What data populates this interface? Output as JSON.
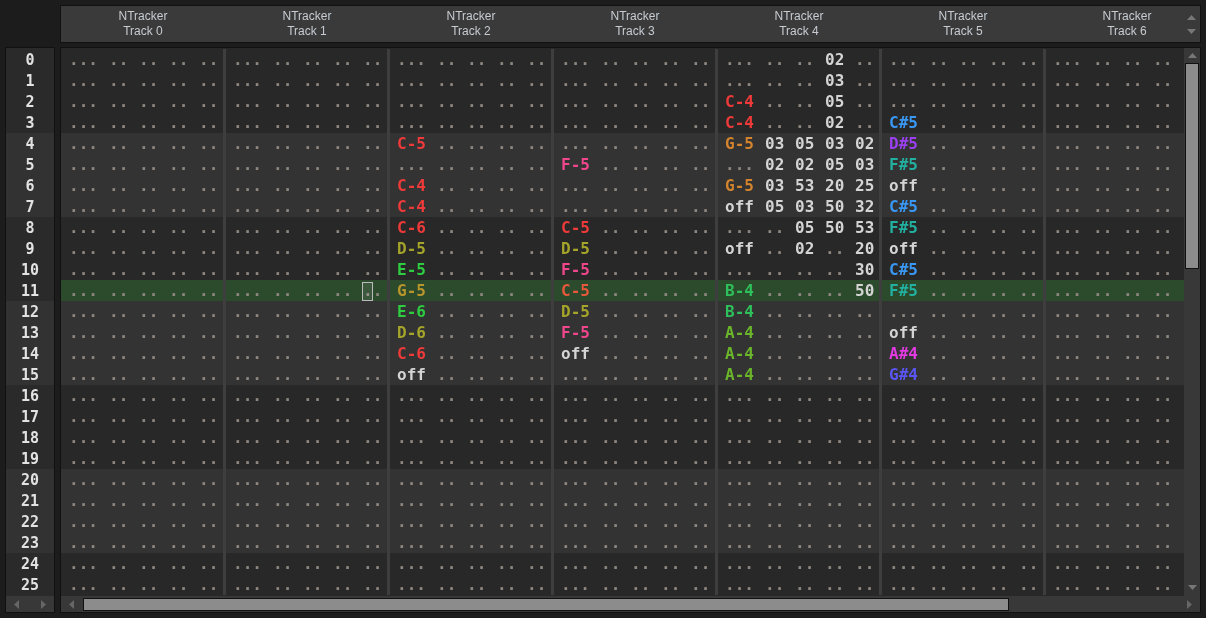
{
  "tracks": [
    {
      "plugin": "NTracker",
      "name": "Track 0",
      "rows": [
        {
          "note": "...",
          "fields": [
            "..",
            "..",
            "..",
            ".."
          ]
        },
        {
          "note": "...",
          "fields": [
            "..",
            "..",
            "..",
            ".."
          ]
        },
        {
          "note": "...",
          "fields": [
            "..",
            "..",
            "..",
            ".."
          ]
        },
        {
          "note": "...",
          "fields": [
            "..",
            "..",
            "..",
            ".."
          ]
        },
        {
          "note": "...",
          "fields": [
            "..",
            "..",
            "..",
            ".."
          ]
        },
        {
          "note": "...",
          "fields": [
            "..",
            "..",
            "..",
            ".."
          ]
        },
        {
          "note": "...",
          "fields": [
            "..",
            "..",
            "..",
            ".."
          ]
        },
        {
          "note": "...",
          "fields": [
            "..",
            "..",
            "..",
            ".."
          ]
        },
        {
          "note": "...",
          "fields": [
            "..",
            "..",
            "..",
            ".."
          ]
        },
        {
          "note": "...",
          "fields": [
            "..",
            "..",
            "..",
            ".."
          ]
        },
        {
          "note": "...",
          "fields": [
            "..",
            "..",
            "..",
            ".."
          ]
        },
        {
          "note": "...",
          "fields": [
            "..",
            "..",
            "..",
            ".."
          ]
        },
        {
          "note": "...",
          "fields": [
            "..",
            "..",
            "..",
            ".."
          ]
        },
        {
          "note": "...",
          "fields": [
            "..",
            "..",
            "..",
            ".."
          ]
        },
        {
          "note": "...",
          "fields": [
            "..",
            "..",
            "..",
            ".."
          ]
        },
        {
          "note": "...",
          "fields": [
            "..",
            "..",
            "..",
            ".."
          ]
        },
        {
          "note": "...",
          "fields": [
            "..",
            "..",
            "..",
            ".."
          ]
        },
        {
          "note": "...",
          "fields": [
            "..",
            "..",
            "..",
            ".."
          ]
        },
        {
          "note": "...",
          "fields": [
            "..",
            "..",
            "..",
            ".."
          ]
        },
        {
          "note": "...",
          "fields": [
            "..",
            "..",
            "..",
            ".."
          ]
        },
        {
          "note": "...",
          "fields": [
            "..",
            "..",
            "..",
            ".."
          ]
        },
        {
          "note": "...",
          "fields": [
            "..",
            "..",
            "..",
            ".."
          ]
        },
        {
          "note": "...",
          "fields": [
            "..",
            "..",
            "..",
            ".."
          ]
        },
        {
          "note": "...",
          "fields": [
            "..",
            "..",
            "..",
            ".."
          ]
        },
        {
          "note": "...",
          "fields": [
            "..",
            "..",
            "..",
            ".."
          ]
        },
        {
          "note": "...",
          "fields": [
            "..",
            "..",
            "..",
            ".."
          ]
        }
      ]
    },
    {
      "plugin": "NTracker",
      "name": "Track 1",
      "rows": [
        {
          "note": "...",
          "fields": [
            "..",
            "..",
            "..",
            ".."
          ]
        },
        {
          "note": "...",
          "fields": [
            "..",
            "..",
            "..",
            ".."
          ]
        },
        {
          "note": "...",
          "fields": [
            "..",
            "..",
            "..",
            ".."
          ]
        },
        {
          "note": "...",
          "fields": [
            "..",
            "..",
            "..",
            ".."
          ]
        },
        {
          "note": "...",
          "fields": [
            "..",
            "..",
            "..",
            ".."
          ]
        },
        {
          "note": "...",
          "fields": [
            "..",
            "..",
            "..",
            ".."
          ]
        },
        {
          "note": "...",
          "fields": [
            "..",
            "..",
            "..",
            ".."
          ]
        },
        {
          "note": "...",
          "fields": [
            "..",
            "..",
            "..",
            ".."
          ]
        },
        {
          "note": "...",
          "fields": [
            "..",
            "..",
            "..",
            ".."
          ]
        },
        {
          "note": "...",
          "fields": [
            "..",
            "..",
            "..",
            ".."
          ]
        },
        {
          "note": "...",
          "fields": [
            "..",
            "..",
            "..",
            ".."
          ]
        },
        {
          "note": "...",
          "fields": [
            "..",
            "..",
            "..",
            ".."
          ],
          "cursor": true
        },
        {
          "note": "...",
          "fields": [
            "..",
            "..",
            "..",
            ".."
          ]
        },
        {
          "note": "...",
          "fields": [
            "..",
            "..",
            "..",
            ".."
          ]
        },
        {
          "note": "...",
          "fields": [
            "..",
            "..",
            "..",
            ".."
          ]
        },
        {
          "note": "...",
          "fields": [
            "..",
            "..",
            "..",
            ".."
          ]
        },
        {
          "note": "...",
          "fields": [
            "..",
            "..",
            "..",
            ".."
          ]
        },
        {
          "note": "...",
          "fields": [
            "..",
            "..",
            "..",
            ".."
          ]
        },
        {
          "note": "...",
          "fields": [
            "..",
            "..",
            "..",
            ".."
          ]
        },
        {
          "note": "...",
          "fields": [
            "..",
            "..",
            "..",
            ".."
          ]
        },
        {
          "note": "...",
          "fields": [
            "..",
            "..",
            "..",
            ".."
          ]
        },
        {
          "note": "...",
          "fields": [
            "..",
            "..",
            "..",
            ".."
          ]
        },
        {
          "note": "...",
          "fields": [
            "..",
            "..",
            "..",
            ".."
          ]
        },
        {
          "note": "...",
          "fields": [
            "..",
            "..",
            "..",
            ".."
          ]
        },
        {
          "note": "...",
          "fields": [
            "..",
            "..",
            "..",
            ".."
          ]
        },
        {
          "note": "...",
          "fields": [
            "..",
            "..",
            "..",
            ".."
          ]
        }
      ]
    },
    {
      "plugin": "NTracker",
      "name": "Track 2",
      "rows": [
        {
          "note": "...",
          "fields": [
            "..",
            "..",
            "..",
            ".."
          ]
        },
        {
          "note": "...",
          "fields": [
            "..",
            "..",
            "..",
            ".."
          ]
        },
        {
          "note": "...",
          "fields": [
            "..",
            "..",
            "..",
            ".."
          ]
        },
        {
          "note": "...",
          "fields": [
            "..",
            "..",
            "..",
            ".."
          ]
        },
        {
          "note": "C-5",
          "color": "#f03a3a",
          "fields": [
            "..",
            "..",
            "..",
            ".."
          ]
        },
        {
          "note": "...",
          "fields": [
            "..",
            "..",
            "..",
            ".."
          ]
        },
        {
          "note": "C-4",
          "color": "#f03a3a",
          "fields": [
            "..",
            "..",
            "..",
            ".."
          ]
        },
        {
          "note": "C-4",
          "color": "#f03a3a",
          "fields": [
            "..",
            "..",
            "..",
            ".."
          ]
        },
        {
          "note": "C-6",
          "color": "#f03a3a",
          "fields": [
            "..",
            "..",
            "..",
            ".."
          ]
        },
        {
          "note": "D-5",
          "color": "#a5a52a",
          "fields": [
            "..",
            "..",
            "..",
            ".."
          ]
        },
        {
          "note": "E-5",
          "color": "#2ecc40",
          "fields": [
            "..",
            "..",
            "..",
            ".."
          ]
        },
        {
          "note": "G-5",
          "color": "#b8962c",
          "fields": [
            "..",
            "..",
            "..",
            ".."
          ]
        },
        {
          "note": "E-6",
          "color": "#2ecc40",
          "fields": [
            "..",
            "..",
            "..",
            ".."
          ]
        },
        {
          "note": "D-6",
          "color": "#a5a52a",
          "fields": [
            "..",
            "..",
            "..",
            ".."
          ]
        },
        {
          "note": "C-6",
          "color": "#f03a3a",
          "fields": [
            "..",
            "..",
            "..",
            ".."
          ]
        },
        {
          "note": "off",
          "fields": [
            "..",
            "..",
            "..",
            ".."
          ]
        },
        {
          "note": "...",
          "fields": [
            "..",
            "..",
            "..",
            ".."
          ]
        },
        {
          "note": "...",
          "fields": [
            "..",
            "..",
            "..",
            ".."
          ]
        },
        {
          "note": "...",
          "fields": [
            "..",
            "..",
            "..",
            ".."
          ]
        },
        {
          "note": "...",
          "fields": [
            "..",
            "..",
            "..",
            ".."
          ]
        },
        {
          "note": "...",
          "fields": [
            "..",
            "..",
            "..",
            ".."
          ]
        },
        {
          "note": "...",
          "fields": [
            "..",
            "..",
            "..",
            ".."
          ]
        },
        {
          "note": "...",
          "fields": [
            "..",
            "..",
            "..",
            ".."
          ]
        },
        {
          "note": "...",
          "fields": [
            "..",
            "..",
            "..",
            ".."
          ]
        },
        {
          "note": "...",
          "fields": [
            "..",
            "..",
            "..",
            ".."
          ]
        },
        {
          "note": "...",
          "fields": [
            "..",
            "..",
            "..",
            ".."
          ]
        }
      ]
    },
    {
      "plugin": "NTracker",
      "name": "Track 3",
      "rows": [
        {
          "note": "...",
          "fields": [
            "..",
            "..",
            "..",
            ".."
          ]
        },
        {
          "note": "...",
          "fields": [
            "..",
            "..",
            "..",
            ".."
          ]
        },
        {
          "note": "...",
          "fields": [
            "..",
            "..",
            "..",
            ".."
          ]
        },
        {
          "note": "...",
          "fields": [
            "..",
            "..",
            "..",
            ".."
          ]
        },
        {
          "note": "...",
          "fields": [
            "..",
            "..",
            "..",
            ".."
          ]
        },
        {
          "note": "F-5",
          "color": "#f0468c",
          "fields": [
            "..",
            "..",
            "..",
            ".."
          ]
        },
        {
          "note": "...",
          "fields": [
            "..",
            "..",
            "..",
            ".."
          ]
        },
        {
          "note": "...",
          "fields": [
            "..",
            "..",
            "..",
            ".."
          ]
        },
        {
          "note": "C-5",
          "color": "#f03a3a",
          "fields": [
            "..",
            "..",
            "..",
            ".."
          ]
        },
        {
          "note": "D-5",
          "color": "#a5a52a",
          "fields": [
            "..",
            "..",
            "..",
            ".."
          ]
        },
        {
          "note": "F-5",
          "color": "#f0468c",
          "fields": [
            "..",
            "..",
            "..",
            ".."
          ]
        },
        {
          "note": "C-5",
          "color": "#e8583a",
          "fields": [
            "..",
            "..",
            "..",
            ".."
          ]
        },
        {
          "note": "D-5",
          "color": "#a5a52a",
          "fields": [
            "..",
            "..",
            "..",
            ".."
          ]
        },
        {
          "note": "F-5",
          "color": "#f0468c",
          "fields": [
            "..",
            "..",
            "..",
            ".."
          ]
        },
        {
          "note": "off",
          "fields": [
            "..",
            "..",
            "..",
            ".."
          ]
        },
        {
          "note": "...",
          "fields": [
            "..",
            "..",
            "..",
            ".."
          ]
        },
        {
          "note": "...",
          "fields": [
            "..",
            "..",
            "..",
            ".."
          ]
        },
        {
          "note": "...",
          "fields": [
            "..",
            "..",
            "..",
            ".."
          ]
        },
        {
          "note": "...",
          "fields": [
            "..",
            "..",
            "..",
            ".."
          ]
        },
        {
          "note": "...",
          "fields": [
            "..",
            "..",
            "..",
            ".."
          ]
        },
        {
          "note": "...",
          "fields": [
            "..",
            "..",
            "..",
            ".."
          ]
        },
        {
          "note": "...",
          "fields": [
            "..",
            "..",
            "..",
            ".."
          ]
        },
        {
          "note": "...",
          "fields": [
            "..",
            "..",
            "..",
            ".."
          ]
        },
        {
          "note": "...",
          "fields": [
            "..",
            "..",
            "..",
            ".."
          ]
        },
        {
          "note": "...",
          "fields": [
            "..",
            "..",
            "..",
            ".."
          ]
        },
        {
          "note": "...",
          "fields": [
            "..",
            "..",
            "..",
            ".."
          ]
        }
      ]
    },
    {
      "plugin": "NTracker",
      "name": "Track 4",
      "rows": [
        {
          "note": "...",
          "fields": [
            "..",
            "..",
            "02",
            ".."
          ]
        },
        {
          "note": "...",
          "fields": [
            "..",
            "..",
            "03",
            ".."
          ]
        },
        {
          "note": "C-4",
          "color": "#f03a3a",
          "fields": [
            "..",
            "..",
            "05",
            ".."
          ]
        },
        {
          "note": "C-4",
          "color": "#f03a3a",
          "fields": [
            "..",
            "..",
            "02",
            ".."
          ]
        },
        {
          "note": "G-5",
          "color": "#d4842c",
          "fields": [
            "03",
            "05",
            "03",
            "02"
          ]
        },
        {
          "note": "...",
          "fields": [
            "02",
            "02",
            "05",
            "03"
          ]
        },
        {
          "note": "G-5",
          "color": "#d4842c",
          "fields": [
            "03",
            "53",
            "20",
            "25"
          ]
        },
        {
          "note": "off",
          "fields": [
            "05",
            "03",
            "50",
            "32"
          ]
        },
        {
          "note": "...",
          "fields": [
            "..",
            "05",
            "50",
            "53"
          ]
        },
        {
          "note": "off",
          "fields": [
            "..",
            "02",
            "..",
            "20"
          ]
        },
        {
          "note": "...",
          "fields": [
            "..",
            "..",
            "..",
            "30"
          ]
        },
        {
          "note": "B-4",
          "color": "#2ec05a",
          "fields": [
            "..",
            "..",
            "..",
            "50"
          ]
        },
        {
          "note": "B-4",
          "color": "#2ec05a",
          "fields": [
            "..",
            "..",
            "..",
            ".."
          ]
        },
        {
          "note": "A-4",
          "color": "#6ab52a",
          "fields": [
            "..",
            "..",
            "..",
            ".."
          ]
        },
        {
          "note": "A-4",
          "color": "#6ab52a",
          "fields": [
            "..",
            "..",
            "..",
            ".."
          ]
        },
        {
          "note": "A-4",
          "color": "#6ab52a",
          "fields": [
            "..",
            "..",
            "..",
            ".."
          ]
        },
        {
          "note": "...",
          "fields": [
            "..",
            "..",
            "..",
            ".."
          ]
        },
        {
          "note": "...",
          "fields": [
            "..",
            "..",
            "..",
            ".."
          ]
        },
        {
          "note": "...",
          "fields": [
            "..",
            "..",
            "..",
            ".."
          ]
        },
        {
          "note": "...",
          "fields": [
            "..",
            "..",
            "..",
            ".."
          ]
        },
        {
          "note": "...",
          "fields": [
            "..",
            "..",
            "..",
            ".."
          ]
        },
        {
          "note": "...",
          "fields": [
            "..",
            "..",
            "..",
            ".."
          ]
        },
        {
          "note": "...",
          "fields": [
            "..",
            "..",
            "..",
            ".."
          ]
        },
        {
          "note": "...",
          "fields": [
            "..",
            "..",
            "..",
            ".."
          ]
        },
        {
          "note": "...",
          "fields": [
            "..",
            "..",
            "..",
            ".."
          ]
        },
        {
          "note": "...",
          "fields": [
            "..",
            "..",
            "..",
            ".."
          ]
        }
      ]
    },
    {
      "plugin": "NTracker",
      "name": "Track 5",
      "rows": [
        {
          "note": "...",
          "fields": [
            "..",
            "..",
            "..",
            ".."
          ]
        },
        {
          "note": "...",
          "fields": [
            "..",
            "..",
            "..",
            ".."
          ]
        },
        {
          "note": "...",
          "fields": [
            "..",
            "..",
            "..",
            ".."
          ]
        },
        {
          "note": "C#5",
          "color": "#3a98f5",
          "fields": [
            "..",
            "..",
            "..",
            ".."
          ]
        },
        {
          "note": "D#5",
          "color": "#9a40f0",
          "fields": [
            "..",
            "..",
            "..",
            ".."
          ]
        },
        {
          "note": "F#5",
          "color": "#22b0a0",
          "fields": [
            "..",
            "..",
            "..",
            ".."
          ]
        },
        {
          "note": "off",
          "fields": [
            "..",
            "..",
            "..",
            ".."
          ]
        },
        {
          "note": "C#5",
          "color": "#3a98f5",
          "fields": [
            "..",
            "..",
            "..",
            ".."
          ]
        },
        {
          "note": "F#5",
          "color": "#22b0a0",
          "fields": [
            "..",
            "..",
            "..",
            ".."
          ]
        },
        {
          "note": "off",
          "fields": [
            "..",
            "..",
            "..",
            ".."
          ]
        },
        {
          "note": "C#5",
          "color": "#3a98f5",
          "fields": [
            "..",
            "..",
            "..",
            ".."
          ]
        },
        {
          "note": "F#5",
          "color": "#22b0a0",
          "fields": [
            "..",
            "..",
            "..",
            ".."
          ]
        },
        {
          "note": "...",
          "fields": [
            "..",
            "..",
            "..",
            ".."
          ]
        },
        {
          "note": "off",
          "fields": [
            "..",
            "..",
            "..",
            ".."
          ]
        },
        {
          "note": "A#4",
          "color": "#e03ae0",
          "fields": [
            "..",
            "..",
            "..",
            ".."
          ]
        },
        {
          "note": "G#4",
          "color": "#5a55f5",
          "fields": [
            "..",
            "..",
            "..",
            ".."
          ]
        },
        {
          "note": "...",
          "fields": [
            "..",
            "..",
            "..",
            ".."
          ]
        },
        {
          "note": "...",
          "fields": [
            "..",
            "..",
            "..",
            ".."
          ]
        },
        {
          "note": "...",
          "fields": [
            "..",
            "..",
            "..",
            ".."
          ]
        },
        {
          "note": "...",
          "fields": [
            "..",
            "..",
            "..",
            ".."
          ]
        },
        {
          "note": "...",
          "fields": [
            "..",
            "..",
            "..",
            ".."
          ]
        },
        {
          "note": "...",
          "fields": [
            "..",
            "..",
            "..",
            ".."
          ]
        },
        {
          "note": "...",
          "fields": [
            "..",
            "..",
            "..",
            ".."
          ]
        },
        {
          "note": "...",
          "fields": [
            "..",
            "..",
            "..",
            ".."
          ]
        },
        {
          "note": "...",
          "fields": [
            "..",
            "..",
            "..",
            ".."
          ]
        },
        {
          "note": "...",
          "fields": [
            "..",
            "..",
            "..",
            ".."
          ]
        }
      ]
    },
    {
      "plugin": "NTracker",
      "name": "Track 6",
      "rows": [
        {
          "note": "...",
          "fields": [
            "..",
            "..",
            ".."
          ]
        },
        {
          "note": "...",
          "fields": [
            "..",
            "..",
            ".."
          ]
        },
        {
          "note": "...",
          "fields": [
            "..",
            "..",
            ".."
          ]
        },
        {
          "note": "...",
          "fields": [
            "..",
            "..",
            ".."
          ]
        },
        {
          "note": "...",
          "fields": [
            "..",
            "..",
            ".."
          ]
        },
        {
          "note": "...",
          "fields": [
            "..",
            "..",
            ".."
          ]
        },
        {
          "note": "...",
          "fields": [
            "..",
            "..",
            ".."
          ]
        },
        {
          "note": "...",
          "fields": [
            "..",
            "..",
            ".."
          ]
        },
        {
          "note": "...",
          "fields": [
            "..",
            "..",
            ".."
          ]
        },
        {
          "note": "...",
          "fields": [
            "..",
            "..",
            ".."
          ]
        },
        {
          "note": "...",
          "fields": [
            "..",
            "..",
            ".."
          ]
        },
        {
          "note": "...",
          "fields": [
            "..",
            "..",
            ".."
          ]
        },
        {
          "note": "...",
          "fields": [
            "..",
            "..",
            ".."
          ]
        },
        {
          "note": "...",
          "fields": [
            "..",
            "..",
            ".."
          ]
        },
        {
          "note": "...",
          "fields": [
            "..",
            "..",
            ".."
          ]
        },
        {
          "note": "...",
          "fields": [
            "..",
            "..",
            ".."
          ]
        },
        {
          "note": "...",
          "fields": [
            "..",
            "..",
            ".."
          ]
        },
        {
          "note": "...",
          "fields": [
            "..",
            "..",
            ".."
          ]
        },
        {
          "note": "...",
          "fields": [
            "..",
            "..",
            ".."
          ]
        },
        {
          "note": "...",
          "fields": [
            "..",
            "..",
            ".."
          ]
        },
        {
          "note": "...",
          "fields": [
            "..",
            "..",
            ".."
          ]
        },
        {
          "note": "...",
          "fields": [
            "..",
            "..",
            ".."
          ]
        },
        {
          "note": "...",
          "fields": [
            "..",
            "..",
            ".."
          ]
        },
        {
          "note": "...",
          "fields": [
            "..",
            "..",
            ".."
          ]
        },
        {
          "note": "...",
          "fields": [
            "..",
            "..",
            ".."
          ]
        },
        {
          "note": "...",
          "fields": [
            "..",
            "..",
            ".."
          ]
        }
      ]
    }
  ],
  "rows": [
    {
      "label": "0",
      "selected": false
    },
    {
      "label": "1",
      "selected": false
    },
    {
      "label": "2",
      "selected": false
    },
    {
      "label": "3",
      "selected": false
    },
    {
      "label": "4",
      "selected": false
    },
    {
      "label": "5",
      "selected": false
    },
    {
      "label": "6",
      "selected": false
    },
    {
      "label": "7",
      "selected": false
    },
    {
      "label": "8",
      "selected": false
    },
    {
      "label": "9",
      "selected": false
    },
    {
      "label": "10",
      "selected": false
    },
    {
      "label": "11",
      "selected": true
    },
    {
      "label": "12",
      "selected": false
    },
    {
      "label": "13",
      "selected": false
    },
    {
      "label": "14",
      "selected": false
    },
    {
      "label": "15",
      "selected": false
    },
    {
      "label": "16",
      "selected": false
    },
    {
      "label": "17",
      "selected": false
    },
    {
      "label": "18",
      "selected": false
    },
    {
      "label": "19",
      "selected": false
    },
    {
      "label": "20",
      "selected": false
    },
    {
      "label": "21",
      "selected": false
    },
    {
      "label": "22",
      "selected": false
    },
    {
      "label": "23",
      "selected": false
    },
    {
      "label": "24",
      "selected": false
    },
    {
      "label": "25",
      "selected": false
    }
  ]
}
